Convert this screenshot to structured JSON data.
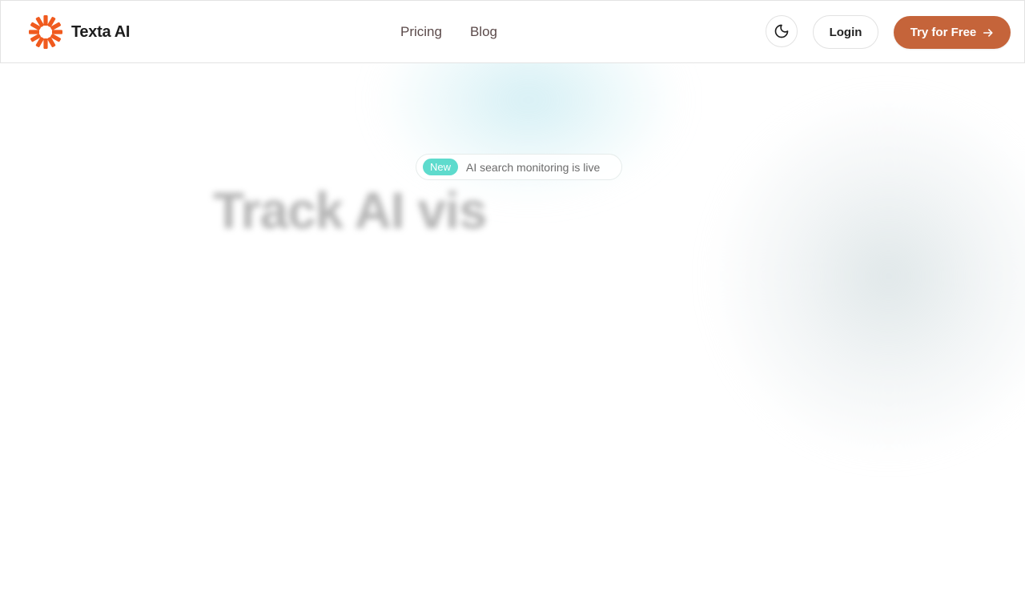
{
  "brand": {
    "name": "Texta AI",
    "logo_icon": "sunburst-logo-icon",
    "logo_color": "#f05a1e"
  },
  "nav": {
    "items": [
      {
        "label": "Pricing"
      },
      {
        "label": "Blog"
      }
    ]
  },
  "header_actions": {
    "theme_toggle_icon": "moon-icon",
    "login_label": "Login",
    "cta_label": "Try for Free",
    "cta_icon": "arrow-right-icon",
    "cta_color": "#c5643a"
  },
  "hero": {
    "badge_label": "New",
    "badge_color": "#5edbcd",
    "announcement_text": "AI search monitoring is live",
    "headline": "Track AI vis"
  }
}
